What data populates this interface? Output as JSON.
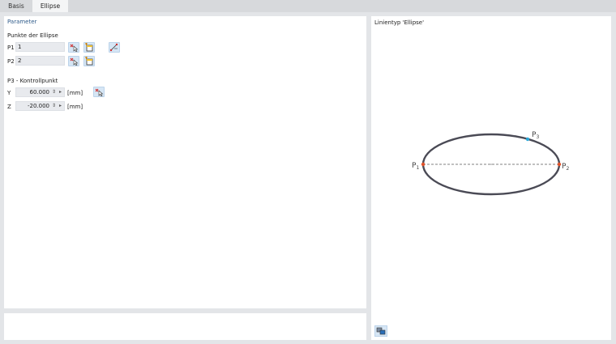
{
  "tabs": [
    {
      "label": "Basis",
      "active": false
    },
    {
      "label": "Ellipse",
      "active": true
    }
  ],
  "parameters": {
    "section_title": "Parameter",
    "points_heading": "Punkte der Ellipse",
    "p1": {
      "label": "P1",
      "value": "1"
    },
    "p2": {
      "label": "P2",
      "value": "2"
    },
    "control_heading": "P3 - Kontrollpunkt",
    "y": {
      "label": "Y",
      "value": "60.000",
      "unit": "[mm]"
    },
    "z": {
      "label": "Z",
      "value": "-20.000",
      "unit": "[mm]"
    }
  },
  "preview": {
    "title": "Linientyp 'Ellipse'",
    "labels": {
      "p1": "P",
      "p1_sub": "1",
      "p2": "P",
      "p2_sub": "2",
      "p3": "P",
      "p3_sub": "3"
    },
    "colors": {
      "ellipse": "#4a4a55",
      "endpoint": "#e0522a",
      "control_point": "#2aa7d8",
      "axis": "#5a5a5a"
    }
  },
  "icons": {
    "pick_node": "pick-node-icon",
    "new_node": "new-node-icon",
    "two_point": "two-point-icon",
    "pick_point": "pick-point-icon",
    "view_options": "view-options-icon"
  }
}
